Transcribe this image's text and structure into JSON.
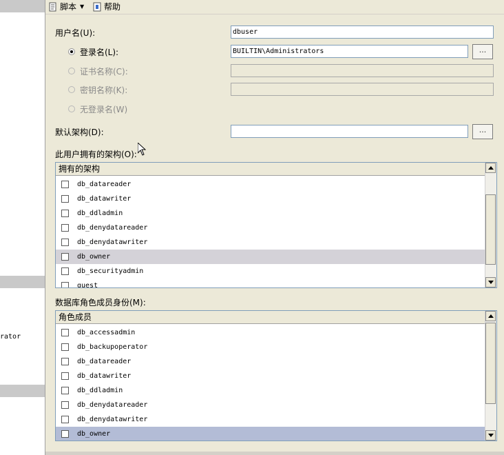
{
  "toolbar": {
    "script_label": "脚本",
    "help_label": "帮助"
  },
  "left_pane": {
    "partial_text": "rator"
  },
  "form": {
    "username_label": "用户名(U):",
    "username_value": "dbuser",
    "login_name_label": "登录名(L):",
    "login_name_value": "BUILTIN\\Administrators",
    "login_browse_label": "...",
    "cert_name_label": "证书名称(C):",
    "key_name_label": "密钥名称(K):",
    "no_login_label": "无登录名(W)",
    "default_schema_label": "默认架构(D):",
    "default_schema_value": "",
    "schema_browse_label": "...",
    "login_type_selected": "登录名(L)"
  },
  "owned_schemas": {
    "section_label": "此用户拥有的架构(O):",
    "column_header": "拥有的架构",
    "rows": [
      {
        "name": "db_datareader",
        "checked": false
      },
      {
        "name": "db_datawriter",
        "checked": false
      },
      {
        "name": "db_ddladmin",
        "checked": false
      },
      {
        "name": "db_denydatareader",
        "checked": false
      },
      {
        "name": "db_denydatawriter",
        "checked": false
      },
      {
        "name": "db_owner",
        "checked": false
      },
      {
        "name": "db_securityadmin",
        "checked": false
      },
      {
        "name": "guest",
        "checked": false
      }
    ]
  },
  "role_members": {
    "section_label": "数据库角色成员身份(M):",
    "column_header": "角色成员",
    "rows": [
      {
        "name": "db_accessadmin",
        "checked": false
      },
      {
        "name": "db_backupoperator",
        "checked": false
      },
      {
        "name": "db_datareader",
        "checked": false
      },
      {
        "name": "db_datawriter",
        "checked": false
      },
      {
        "name": "db_ddladmin",
        "checked": false
      },
      {
        "name": "db_denydatareader",
        "checked": false
      },
      {
        "name": "db_denydatawriter",
        "checked": false
      },
      {
        "name": "db_owner",
        "checked": false
      }
    ]
  },
  "colors": {
    "window_bg": "#ece9d8",
    "hover_row": "#d4d2d8",
    "selected_row": "#b3bcd6",
    "input_border": "#7f9db9"
  }
}
